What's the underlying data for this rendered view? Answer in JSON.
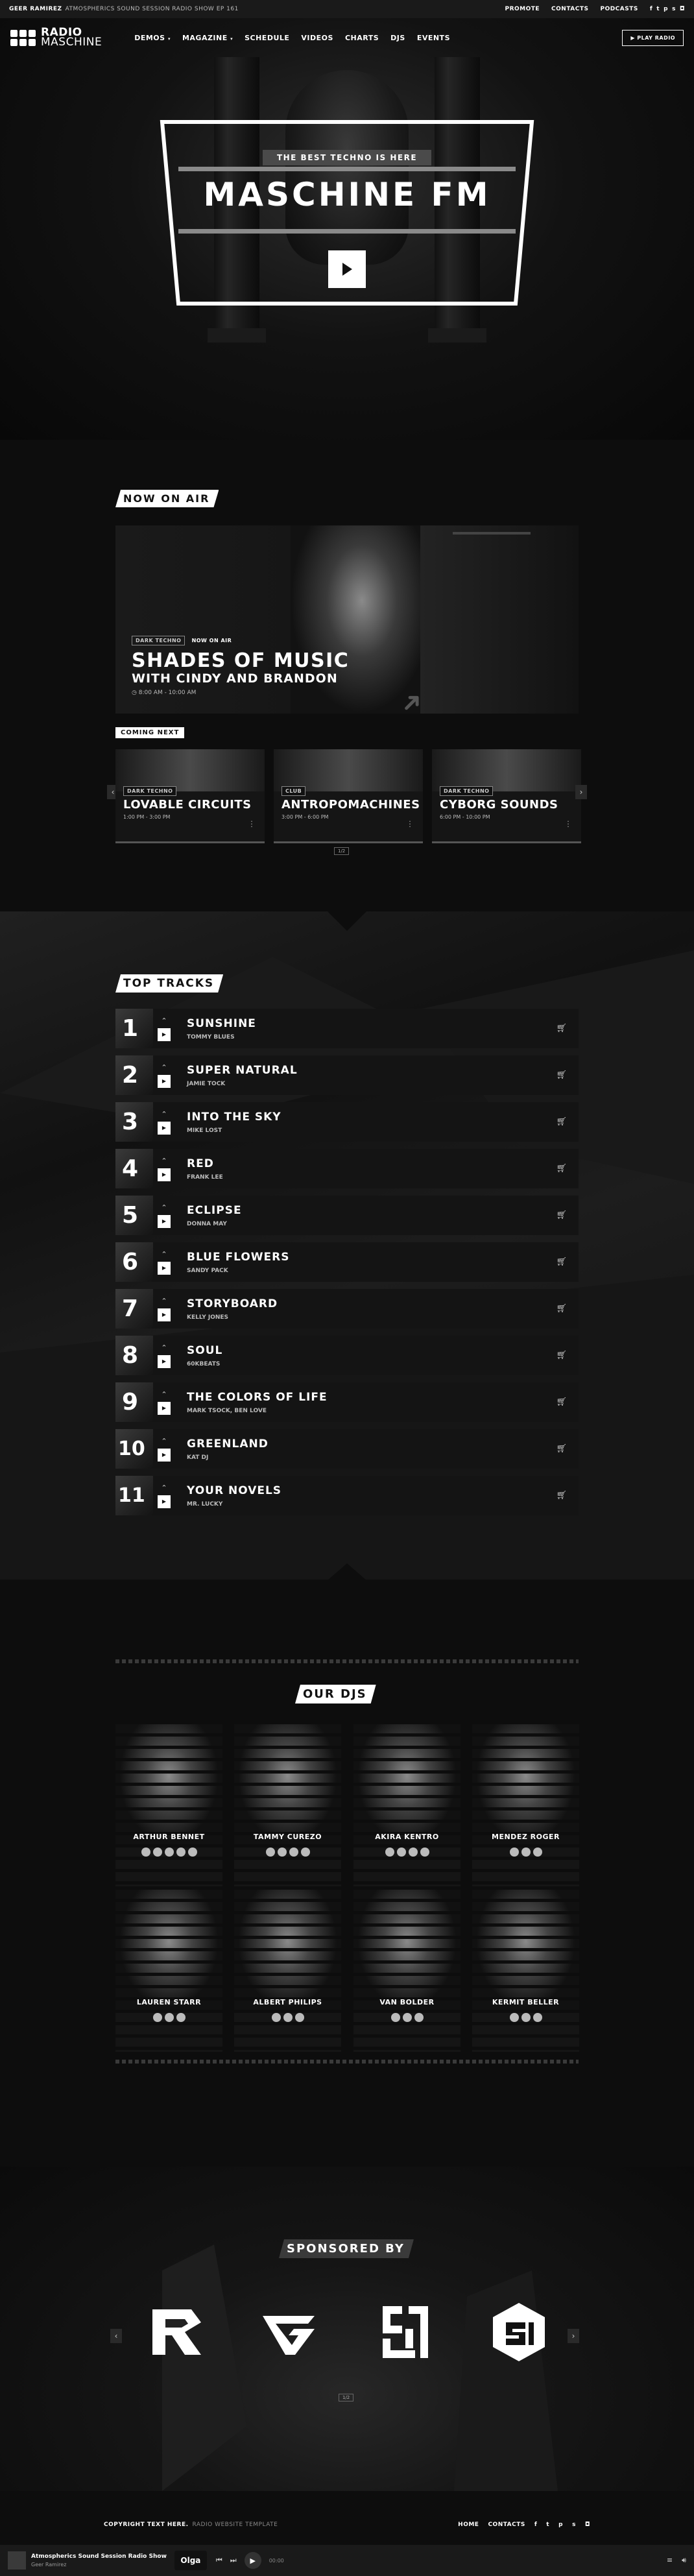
{
  "topbar": {
    "now_dj": "GEER RAMIREZ",
    "now_show": "ATMOSPHERICS SOUND SESSION RADIO SHOW EP 161",
    "links": [
      "PROMOTE",
      "CONTACTS",
      "PODCASTS"
    ]
  },
  "header": {
    "logo_line1": "RADIO",
    "logo_line2": "MASCHINE",
    "nav": [
      "DEMOS",
      "MAGAZINE",
      "SCHEDULE",
      "VIDEOS",
      "CHARTS",
      "DJS",
      "EVENTS"
    ],
    "play_button": "▶ PLAY RADIO"
  },
  "hero": {
    "badge": "THE BEST TECHNO IS HERE",
    "title": "MASCHINE FM"
  },
  "onair": {
    "section_title": "NOW ON AIR",
    "genre_tag": "DARK TECHNO",
    "status": "NOW ON AIR",
    "show": "SHADES OF MUSIC",
    "with": "WITH CINDY AND BRANDON",
    "time": "8:00 AM - 10:00 AM"
  },
  "coming": {
    "label": "COMING NEXT",
    "cards": [
      {
        "title": "LOVABLE CIRCUITS",
        "time": "1:00 PM - 3:00 PM",
        "tags": [
          "DARK TECHNO"
        ]
      },
      {
        "title": "ANTROPOMACHINES",
        "time": "3:00 PM - 6:00 PM",
        "tags": [
          "CLUB"
        ]
      },
      {
        "title": "CYBORG SOUNDS",
        "time": "6:00 PM - 10:00 PM",
        "tags": [
          "DARK TECHNO"
        ]
      }
    ],
    "pager": "1/2"
  },
  "tracks": {
    "section_title": "TOP TRACKS",
    "items": [
      {
        "num": "1",
        "title": "SUNSHINE",
        "artist": "TOMMY BLUES"
      },
      {
        "num": "2",
        "title": "SUPER NATURAL",
        "artist": "JAMIE TOCK"
      },
      {
        "num": "3",
        "title": "INTO THE SKY",
        "artist": "MIKE LOST"
      },
      {
        "num": "4",
        "title": "RED",
        "artist": "FRANK LEE"
      },
      {
        "num": "5",
        "title": "ECLIPSE",
        "artist": "DONNA MAY"
      },
      {
        "num": "6",
        "title": "BLUE FLOWERS",
        "artist": "SANDY PACK"
      },
      {
        "num": "7",
        "title": "STORYBOARD",
        "artist": "KELLY JONES"
      },
      {
        "num": "8",
        "title": "SOUL",
        "artist": "60KBEATS"
      },
      {
        "num": "9",
        "title": "THE COLORS OF LIFE",
        "artist": "MARK TSOCK, BEN LOVE"
      },
      {
        "num": "10",
        "title": "GREENLAND",
        "artist": "KAT DJ"
      },
      {
        "num": "11",
        "title": "YOUR NOVELS",
        "artist": "MR. LUCKY"
      }
    ]
  },
  "djs": {
    "section_title": "OUR DJS",
    "items": [
      {
        "name": "ARTHUR BENNET"
      },
      {
        "name": "TAMMY CUREZO"
      },
      {
        "name": "AKIRA KENTRO"
      },
      {
        "name": "MENDEZ ROGER"
      },
      {
        "name": "LAUREN STARR"
      },
      {
        "name": "ALBERT PHILIPS"
      },
      {
        "name": "VAN BOLDER"
      },
      {
        "name": "KERMIT BELLER"
      }
    ]
  },
  "sponsors": {
    "section_title": "SPONSORED BY",
    "pager": "1/2"
  },
  "footer": {
    "copyright_label": "COPYRIGHT TEXT HERE.",
    "copyright_text": "RADIO WEBSITE TEMPLATE",
    "links": [
      "HOME",
      "CONTACTS"
    ]
  },
  "player": {
    "track_title": "Atmospherics Sound Session Radio Show",
    "track_artist": "Geer Ramirez",
    "station_logo": "Olga",
    "time": "00:00"
  },
  "colors": {
    "background": "#0d0d0d",
    "accent": "#ffffff"
  }
}
